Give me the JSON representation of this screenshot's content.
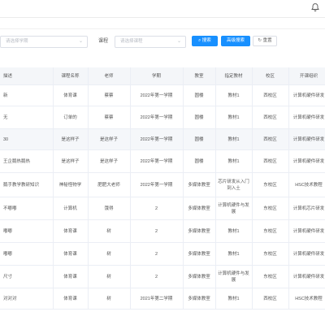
{
  "header": {
    "bell_icon": "bell-icon"
  },
  "filters": {
    "teacher_select_placeholder": "请选择学期",
    "course_label": "课程",
    "course_select_placeholder": "请选择课程",
    "search_button": "搜索",
    "advanced_search_button": "高级搜索",
    "reset_button": "重置"
  },
  "table": {
    "columns": [
      "描述",
      "课程名称",
      "老师",
      "学期",
      "教室",
      "指定教材",
      "校区",
      "开课组织"
    ],
    "rows": [
      [
        "新",
        "体育课",
        "蔡蔡",
        "2022年第一学期",
        "圆楼",
        "教材1",
        "西校区",
        "计算机硬件研发"
      ],
      [
        "无",
        "订单的",
        "蔡蔡",
        "2022年第一学期",
        "圆楼",
        "教材1",
        "西校区",
        "计算机硬件研发"
      ],
      [
        "30",
        "是这样子",
        "是这样子",
        "2022年第一学期",
        "圆楼",
        "教材1",
        "西校区",
        "计算机硬件研发"
      ],
      [
        "王企鹅热鹅热",
        "是这样子",
        "是这样子",
        "2022年第一学期",
        "圆楼",
        "教材1",
        "西校区",
        "计算机硬件研发"
      ],
      [
        "鹅手教学教研知识",
        "神秘怪物学",
        "肥肥大老师",
        "2022年第一学期",
        "多媒体教室",
        "芯片研发从入门到入土",
        "东校区",
        "HSC技术教程"
      ],
      [
        "不嘟嘟",
        "计算机",
        "饿得",
        "2",
        "多媒体教室",
        "计算机硬件与发展",
        "东校区",
        "计算机芯片研发"
      ],
      [
        "嘟嘟",
        "体育课",
        "树",
        "2",
        "多媒体教室",
        "教材1",
        "东校区",
        "计算机硬件研发"
      ],
      [
        "嘟嘟",
        "体育课",
        "树",
        "2",
        "多媒体教室",
        "教材1",
        "东校区",
        "计算机硬件研发"
      ],
      [
        "尺寸",
        "体育课",
        "树",
        "2",
        "多媒体教室",
        "计算机硬件与发展",
        "东校区",
        "计算机硬件研发"
      ],
      [
        "对对对",
        "体育课",
        "树",
        "2021年第二学期",
        "多媒体教室",
        "教材1",
        "西校区",
        "HSC技术教程"
      ]
    ]
  }
}
